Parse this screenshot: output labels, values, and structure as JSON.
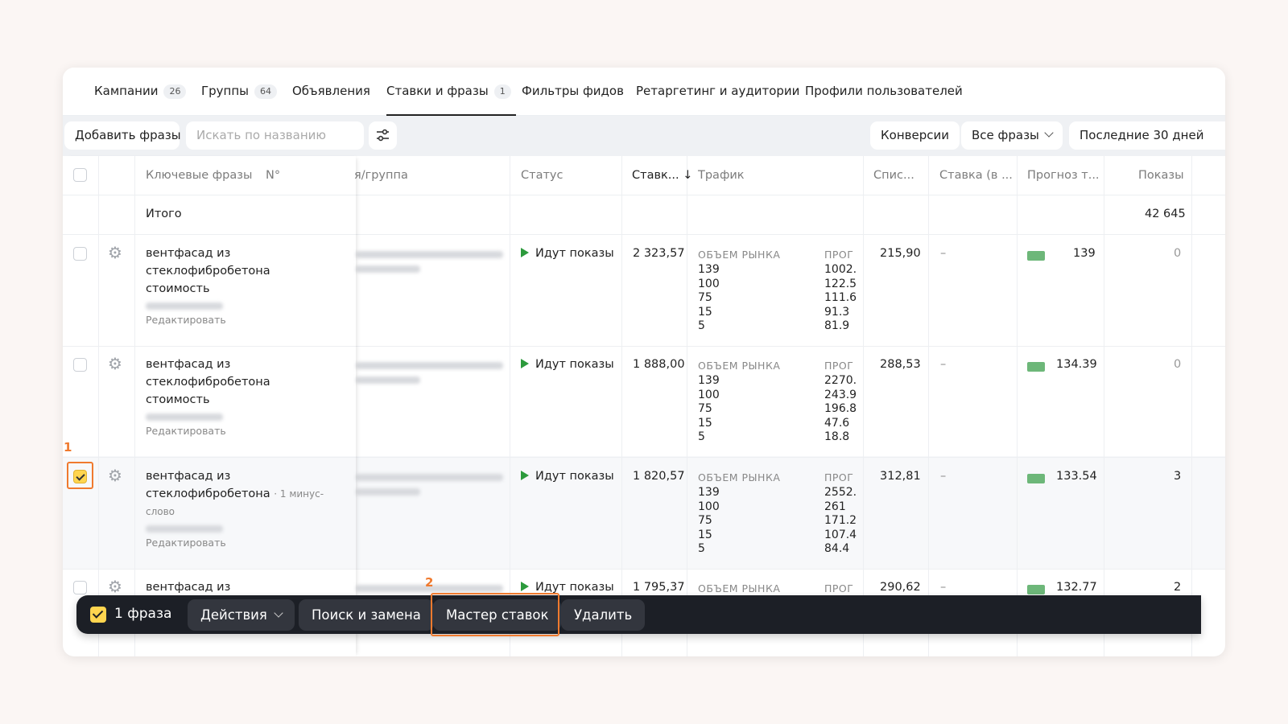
{
  "tabs": [
    {
      "label": "Кампании",
      "count": "26"
    },
    {
      "label": "Группы",
      "count": "64"
    },
    {
      "label": "Объявления",
      "count": ""
    },
    {
      "label": "Ставки и фразы",
      "count": "1"
    },
    {
      "label": "Фильтры фидов",
      "count": ""
    },
    {
      "label": "Ретаргетинг и аудитории",
      "count": ""
    },
    {
      "label": "Профили пользователей",
      "count": ""
    }
  ],
  "toolbar": {
    "add_phrases": "Добавить фразы",
    "search_placeholder": "Искать по названию",
    "conversions": "Конверсии",
    "all_phrases": "Все фразы",
    "period": "Последние 30 дней"
  },
  "columns": {
    "phrases": "Ключевые фразы",
    "number": "N°",
    "campaign_group": "я/группа",
    "status": "Статус",
    "bid": "Ставк... ↓",
    "traffic": "Трафик",
    "charge": "Спис...",
    "bid_net": "Ставка (в ...",
    "forecast": "Прогноз т...",
    "impressions": "Показы"
  },
  "total": {
    "label": "Итого",
    "impressions": "42 645"
  },
  "traffic_labels": {
    "market": "ОБЪЕМ РЫНКА",
    "forecast": "ПРОГ"
  },
  "rows": [
    {
      "phrase": "вентфасад из стеклофибробетона стоимость",
      "minus": "",
      "edit": "Редактировать",
      "status": "Идут показы",
      "bid": "2 323,57",
      "market": [
        "139",
        "100",
        "75",
        "15",
        "5"
      ],
      "forecast": [
        "1002.",
        "122.5",
        "111.6",
        "91.3",
        "81.9"
      ],
      "charge": "215,90",
      "bid_net": "–",
      "forecast_val": "139",
      "impressions": "0",
      "checked": false
    },
    {
      "phrase": "вентфасад из стеклофибробетона стоимость",
      "minus": "",
      "edit": "Редактировать",
      "status": "Идут показы",
      "bid": "1 888,00",
      "market": [
        "139",
        "100",
        "75",
        "15",
        "5"
      ],
      "forecast": [
        "2270.",
        "243.9",
        "196.8",
        "47.6",
        "18.8"
      ],
      "charge": "288,53",
      "bid_net": "–",
      "forecast_val": "134.39",
      "impressions": "0",
      "checked": false
    },
    {
      "phrase": "вентфасад из стеклофибробетона",
      "minus": "· 1 минус-слово",
      "edit": "Редактировать",
      "status": "Идут показы",
      "bid": "1 820,57",
      "market": [
        "139",
        "100",
        "75",
        "15",
        "5"
      ],
      "forecast": [
        "2552.",
        "261",
        "171.2",
        "107.4",
        "84.4"
      ],
      "charge": "312,81",
      "bid_net": "–",
      "forecast_val": "133.54",
      "impressions": "3",
      "checked": true
    },
    {
      "phrase": "вентфасад из",
      "minus": "",
      "edit": "",
      "status": "Идут показы",
      "bid": "1 795,37",
      "market": [],
      "forecast": [],
      "charge": "290,62",
      "bid_net": "–",
      "forecast_val": "132.77",
      "impressions": "2",
      "checked": false
    }
  ],
  "actionbar": {
    "count": "1 фраза",
    "actions": "Действия",
    "search_replace": "Поиск и замена",
    "bid_master": "Мастер ставок",
    "delete": "Удалить"
  },
  "annotations": {
    "one": "1",
    "two": "2",
    "color": "#f07a2e"
  }
}
